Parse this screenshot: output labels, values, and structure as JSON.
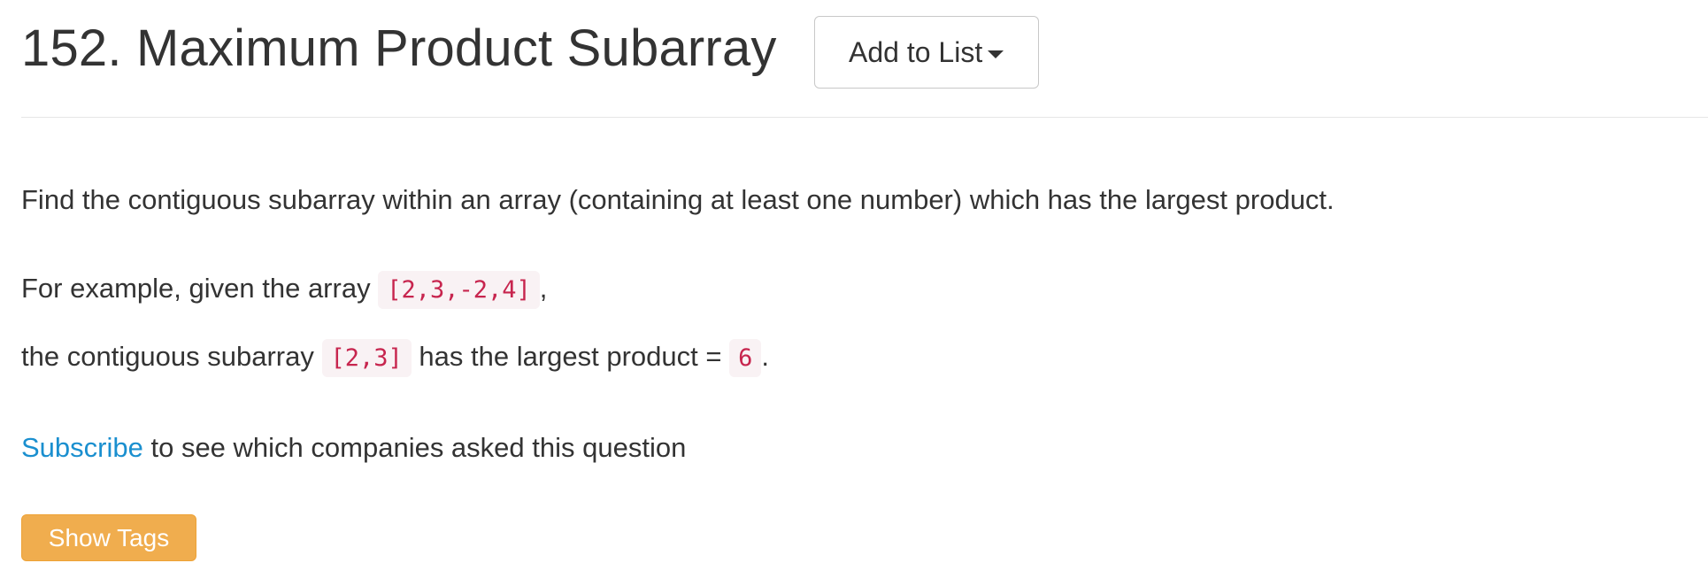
{
  "problem": {
    "title": "152. Maximum Product Subarray",
    "add_to_list_label": "Add to List"
  },
  "description": {
    "line1": "Find the contiguous subarray within an array (containing at least one number) which has the largest product.",
    "line2_prefix": "For example, given the array ",
    "line2_code": "[2,3,-2,4]",
    "line2_suffix": ",",
    "line3_prefix": "the contiguous subarray ",
    "line3_code": "[2,3]",
    "line3_middle": " has the largest product = ",
    "line3_code2": "6",
    "line3_suffix": "."
  },
  "companies": {
    "subscribe_link": "Subscribe",
    "text": " to see which companies asked this question"
  },
  "tags": {
    "show_tags_label": "Show Tags"
  },
  "icons": {
    "dropdown": "caret-down-icon"
  },
  "colors": {
    "text": "#333333",
    "link": "#1a8fcf",
    "code_text": "#c7254e",
    "code_bg": "#f9f2f4",
    "warning_button": "#f0ad4e"
  }
}
